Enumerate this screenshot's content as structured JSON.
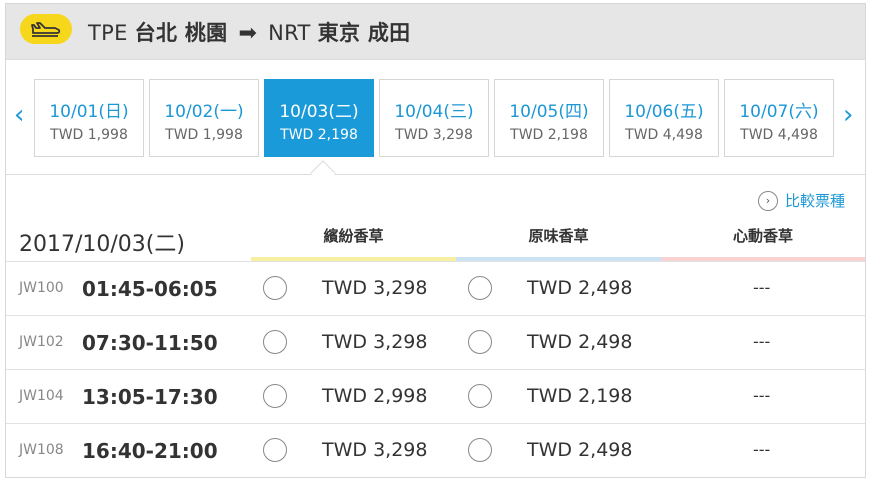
{
  "route": {
    "origin_code": "TPE",
    "origin_city": "台北 桃園",
    "arrow": "➡",
    "dest_code": "NRT",
    "dest_city": "東京 成田",
    "badge_color": "#f7d71c",
    "icon": "airplane-icon"
  },
  "date_nav": {
    "prev_icon": "chevron-left-icon",
    "next_icon": "chevron-right-icon",
    "prev_label": "‹",
    "next_label": "›",
    "dates": [
      {
        "label": "10/01(日)",
        "price": "TWD 1,998",
        "selected": false
      },
      {
        "label": "10/02(一)",
        "price": "TWD 1,998",
        "selected": false
      },
      {
        "label": "10/03(二)",
        "price": "TWD 2,198",
        "selected": true
      },
      {
        "label": "10/04(三)",
        "price": "TWD 3,298",
        "selected": false
      },
      {
        "label": "10/05(四)",
        "price": "TWD 2,198",
        "selected": false
      },
      {
        "label": "10/06(五)",
        "price": "TWD 4,498",
        "selected": false
      },
      {
        "label": "10/07(六)",
        "price": "TWD 4,498",
        "selected": false
      }
    ],
    "accent_color": "#1a9ad9"
  },
  "compare": {
    "label": "比較票種",
    "icon": "chevron-right-circle-icon",
    "icon_glyph": "›"
  },
  "selected_date": "2017/10/03(二)",
  "fare_types": [
    {
      "label": "繽紛香草",
      "color": "#f7f0a0"
    },
    {
      "label": "原味香草",
      "color": "#c9e3f4"
    },
    {
      "label": "心動香草",
      "color": "#f8d3d2"
    }
  ],
  "flights": [
    {
      "flight_no": "JW100",
      "time": "01:45-06:05",
      "fare1": "TWD 3,298",
      "fare2": "TWD 2,498",
      "fare3": "---"
    },
    {
      "flight_no": "JW102",
      "time": "07:30-11:50",
      "fare1": "TWD 3,298",
      "fare2": "TWD 2,498",
      "fare3": "---"
    },
    {
      "flight_no": "JW104",
      "time": "13:05-17:30",
      "fare1": "TWD 2,998",
      "fare2": "TWD 2,198",
      "fare3": "---"
    },
    {
      "flight_no": "JW108",
      "time": "16:40-21:00",
      "fare1": "TWD 3,298",
      "fare2": "TWD 2,498",
      "fare3": "---"
    }
  ]
}
